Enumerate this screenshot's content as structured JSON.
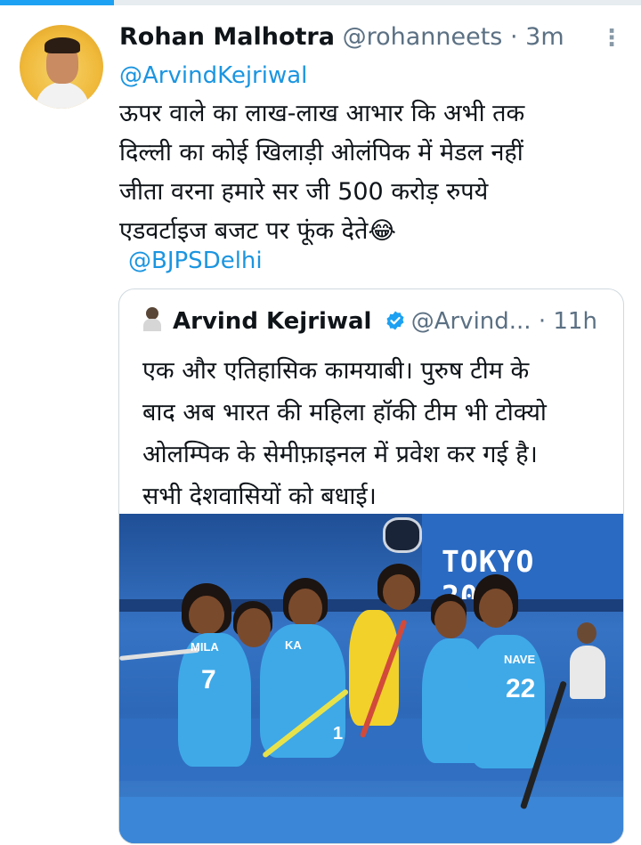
{
  "tweet": {
    "author_name": "Rohan Malhotra",
    "author_handle": "@rohanneets",
    "separator": "·",
    "time": "3m",
    "reply_to": "@ArvindKejriwal",
    "text_lines": [
      "ऊपर वाले का लाख-लाख आभार कि अभी तक",
      "दिल्ली का कोई खिलाड़ी ओलंपिक में मेडल नहीं",
      "जीता वरना हमारे सर जी 500 करोड़ रुपये",
      "एडवर्टाइज बजट पर फूंक देते😂"
    ],
    "mention": "@BJPSDelhi",
    "more_icon": "more-vertical-icon"
  },
  "quoted_tweet": {
    "author_name": "Arvind Kejriwal",
    "author_handle": "@Arvind...",
    "separator": "·",
    "time": "11h",
    "verified_icon": "verified-badge-icon",
    "text_lines": [
      "एक और एतिहासिक कामयाबी। पुरुष टीम के",
      "बाद अब भारत की महिला हॉकी टीम भी टोक्यो",
      "ओलम्पिक के सेमीफ़ाइनल में प्रवेश कर गई है।",
      "सभी देशवासियों को बधाई।"
    ],
    "photo": {
      "banner_text": "TOKYO 2020",
      "jersey_texts": [
        "MILA",
        "KA",
        "NAVE",
        "7",
        "22",
        "1"
      ]
    }
  },
  "colors": {
    "link": "#1b95e0",
    "verified": "#1da1f2",
    "secondary_text": "#5b7083",
    "progress": "#1da1f2"
  }
}
